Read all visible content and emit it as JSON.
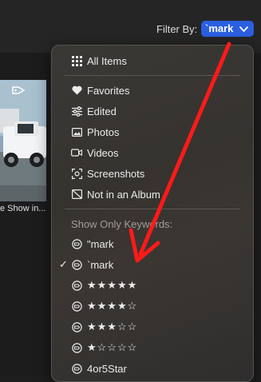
{
  "header": {
    "filter_label": "Filter By:",
    "filter_value": "`mark"
  },
  "background": {
    "thumbnail_caption": "e Show in..."
  },
  "menu": {
    "all_items": "All Items",
    "items": [
      {
        "label": "Favorites",
        "icon": "heart-icon"
      },
      {
        "label": "Edited",
        "icon": "sliders-icon"
      },
      {
        "label": "Photos",
        "icon": "photo-icon"
      },
      {
        "label": "Videos",
        "icon": "video-icon"
      },
      {
        "label": "Screenshots",
        "icon": "screenshot-icon"
      },
      {
        "label": "Not in an Album",
        "icon": "no-album-icon"
      }
    ],
    "keywords_label": "Show Only Keywords:",
    "keywords": [
      {
        "label": "\"mark",
        "checked": false
      },
      {
        "label": "`mark",
        "checked": true
      },
      {
        "label": "★★★★★",
        "checked": false
      },
      {
        "label": "★★★★☆",
        "checked": false
      },
      {
        "label": "★★★☆☆",
        "checked": false
      },
      {
        "label": "★☆☆☆☆",
        "checked": false
      },
      {
        "label": "4or5Star",
        "checked": false
      }
    ],
    "checkmark": "✓"
  },
  "colors": {
    "accent": "#2b5fe0",
    "annotation_arrow": "#ff1a1a"
  }
}
